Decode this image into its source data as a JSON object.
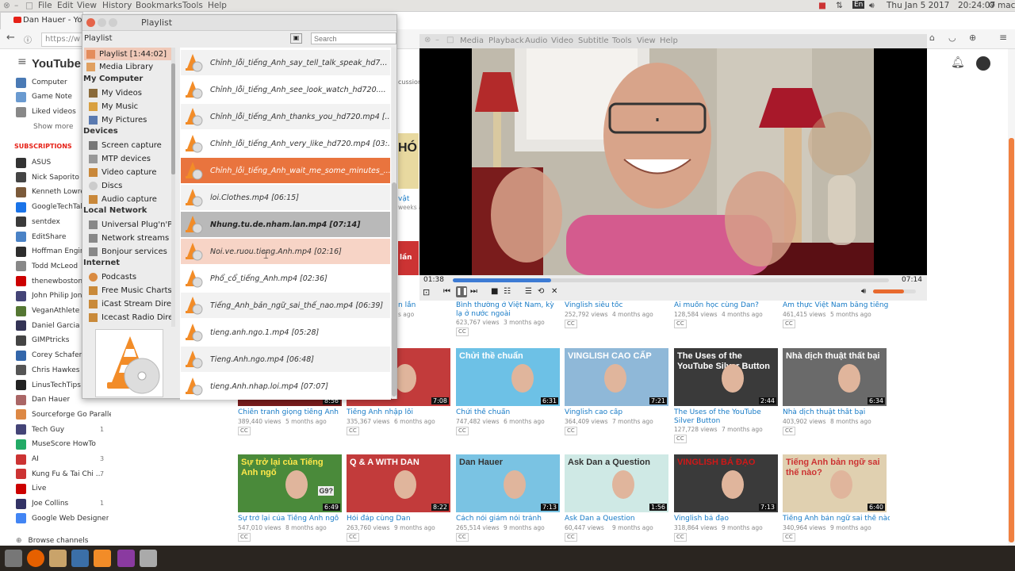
{
  "topbar": {
    "menus": [
      "File",
      "Edit",
      "View",
      "History",
      "Bookmarks",
      "Tools",
      "Help"
    ],
    "lang": "En",
    "datetime": "Thu Jan 5 2017",
    "time": "20:24:07",
    "user": "mac"
  },
  "firefox": {
    "tab_title": "Dan Hauer - You",
    "url": "https://w"
  },
  "youtube": {
    "logo": "YouTube",
    "side_top": [
      "Computer",
      "Game Note",
      "Liked videos",
      "Show more"
    ],
    "subs_header": "SUBSCRIPTIONS",
    "subs": [
      {
        "name": "ASUS",
        "count": ""
      },
      {
        "name": "Nick Saporito",
        "count": ""
      },
      {
        "name": "Kenneth Lowrey",
        "count": ""
      },
      {
        "name": "GoogleTechTalk",
        "count": ""
      },
      {
        "name": "sentdex",
        "count": ""
      },
      {
        "name": "EditShare",
        "count": ""
      },
      {
        "name": "Hoffman Engine",
        "count": ""
      },
      {
        "name": "Todd McLeod",
        "count": ""
      },
      {
        "name": "thenewboston",
        "count": ""
      },
      {
        "name": "John Philip Jone",
        "count": ""
      },
      {
        "name": "VeganAthlete",
        "count": ""
      },
      {
        "name": "Daniel Garcia",
        "count": ""
      },
      {
        "name": "GIMPtricks",
        "count": ""
      },
      {
        "name": "Corey Schafer",
        "count": ""
      },
      {
        "name": "Chris Hawkes",
        "count": ""
      },
      {
        "name": "LinusTechTips",
        "count": ""
      },
      {
        "name": "Dan Hauer",
        "count": ""
      },
      {
        "name": "Sourceforge Go Parallel",
        "count": ""
      },
      {
        "name": "Tech Guy",
        "count": "1"
      },
      {
        "name": "MuseScore HowTo",
        "count": ""
      },
      {
        "name": "AI",
        "count": "3"
      },
      {
        "name": "Kung Fu & Tai Chi ...",
        "count": "7"
      },
      {
        "name": "Live",
        "count": ""
      },
      {
        "name": "Joe Collins",
        "count": "1"
      },
      {
        "name": "Google Web Designer",
        "count": ""
      }
    ],
    "browse_channels": "Browse channels",
    "partial": {
      "discussion": "cussion",
      "vat": "vật",
      "weeks": "weeks ag",
      "lan": "lần",
      "lan2": "n lần",
      "views": "s ago"
    },
    "row1": [
      {
        "title": "Bình thường ở Việt Nam, kỳ lạ ở nước ngoài",
        "views": "623,767 views",
        "ago": "3 months ago"
      },
      {
        "title": "Vinglish siêu tốc",
        "views": "252,792 views",
        "ago": "4 months ago"
      },
      {
        "title": "Ai muốn học cùng Dan?",
        "views": "128,584 views",
        "ago": "4 months ago"
      },
      {
        "title": "Ẩm thực Việt Nam bằng tiếng Anh",
        "views": "461,415 views",
        "ago": "5 months ago"
      }
    ],
    "row2": [
      {
        "title": "Chiến tranh giọng tiếng Anh",
        "views": "389,440 views",
        "ago": "5 months ago",
        "dur": "8:56",
        "thumb": "Chiến tranh giọng"
      },
      {
        "title": "Tiếng Anh nhập lỗi",
        "views": "335,367 views",
        "ago": "6 months ago",
        "dur": "7:08",
        "thumb": "C"
      },
      {
        "title": "Chửi thề chuẩn",
        "views": "747,482 views",
        "ago": "6 months ago",
        "dur": "6:31",
        "thumb": "Chửi thề chuẩn"
      },
      {
        "title": "Vinglish cao cấp",
        "views": "364,409 views",
        "ago": "7 months ago",
        "dur": "7:21",
        "thumb": "VINGLISH CAO CẤP"
      },
      {
        "title": "The Uses of the YouTube Silver Button",
        "views": "127,728 views",
        "ago": "7 months ago",
        "dur": "2:44",
        "thumb": "The Uses of the YouTube Silver Button"
      },
      {
        "title": "Nhà dịch thuật thất bại",
        "views": "403,902 views",
        "ago": "8 months ago",
        "dur": "6:34",
        "thumb": "Nhà dịch thuật thất bại"
      }
    ],
    "row3": [
      {
        "title": "Sự trở lại của Tiếng Anh ngố",
        "views": "547,010 views",
        "ago": "8 months ago",
        "dur": "6:49",
        "thumb": "Sự trở lại của Tiếng Anh ngố",
        "thumb2": "G9?"
      },
      {
        "title": "Hỏi đáp cùng Dan",
        "views": "263,760 views",
        "ago": "9 months ago",
        "dur": "8:22",
        "thumb": "Q & A WITH DAN"
      },
      {
        "title": "Cách nói giảm nói tránh",
        "views": "265,514 views",
        "ago": "9 months ago",
        "dur": "7:13",
        "thumb": "Dan Hauer"
      },
      {
        "title": "Ask Dan a Question",
        "views": "60,447 views",
        "ago": "9 months ago",
        "dur": "1:56",
        "thumb": "Ask Dan a Question"
      },
      {
        "title": "Vinglish bá đạo",
        "views": "318,864 views",
        "ago": "9 months ago",
        "dur": "7:13",
        "thumb": "VINGLISH BÁ ĐẠO"
      },
      {
        "title": "Tiếng Anh bản ngữ sai thế nào?",
        "views": "340,964 views",
        "ago": "9 months ago",
        "dur": "6:40",
        "thumb": "Tiếng Anh bản ngữ sai thế nào?"
      }
    ],
    "cc": "CC"
  },
  "playlist": {
    "window_title": "Playlist",
    "header": "Playlist",
    "search_placeholder": "Search",
    "tree": {
      "playlist": "Playlist [1:44:02]",
      "media_library": "Media Library",
      "my_computer": "My Computer",
      "my_videos": "My Videos",
      "my_music": "My Music",
      "my_pictures": "My Pictures",
      "devices": "Devices",
      "screen_capture": "Screen capture",
      "mtp": "MTP devices",
      "video_capture": "Video capture",
      "discs": "Discs",
      "audio_capture": "Audio capture",
      "local_network": "Local Network",
      "upnp": "Universal Plug'n'P...",
      "network_streams": "Network streams ...",
      "bonjour": "Bonjour services",
      "internet": "Internet",
      "podcasts": "Podcasts",
      "free_music": "Free Music Charts",
      "icast": "iCast Stream Dire...",
      "icecast": "Icecast Radio Dire..."
    },
    "items": [
      "Chỉnh_lỗi_tiếng_Anh_say_tell_talk_speak_hd7...",
      "Chỉnh_lỗi_tiếng_Anh_see_look_watch_hd720....",
      "Chỉnh_lỗi_tiếng_Anh_thanks_you_hd720.mp4 [...",
      "Chỉnh_lỗi_tiếng_Anh_very_like_hd720.mp4 [03:...",
      "Chỉnh_lỗi_tiếng_Anh_wait_me_some_minutes_...",
      "loi.Clothes.mp4 [06:15]",
      "Nhung.tu.de.nham.lan.mp4 [07:14]",
      "Noi.ve.ruou.tieng.Anh.mp4 [02:16]",
      "Phổ_cổ_tiếng_Anh.mp4 [02:36]",
      "Tiếng_Anh_bản_ngữ_sai_thế_nao.mp4 [06:39]",
      "tieng.anh.ngo.1.mp4 [05:28]",
      "Tieng.Anh.ngo.mp4 [06:48]",
      "tieng.Anh.nhap.loi.mp4 [07:07]"
    ]
  },
  "player": {
    "menus": [
      "Media",
      "Playback",
      "Audio",
      "Video",
      "Subtitle",
      "Tools",
      "View",
      "Help"
    ],
    "elapsed": "01:38",
    "total": "07:14",
    "progress": 0.226,
    "volume": 0.72
  }
}
